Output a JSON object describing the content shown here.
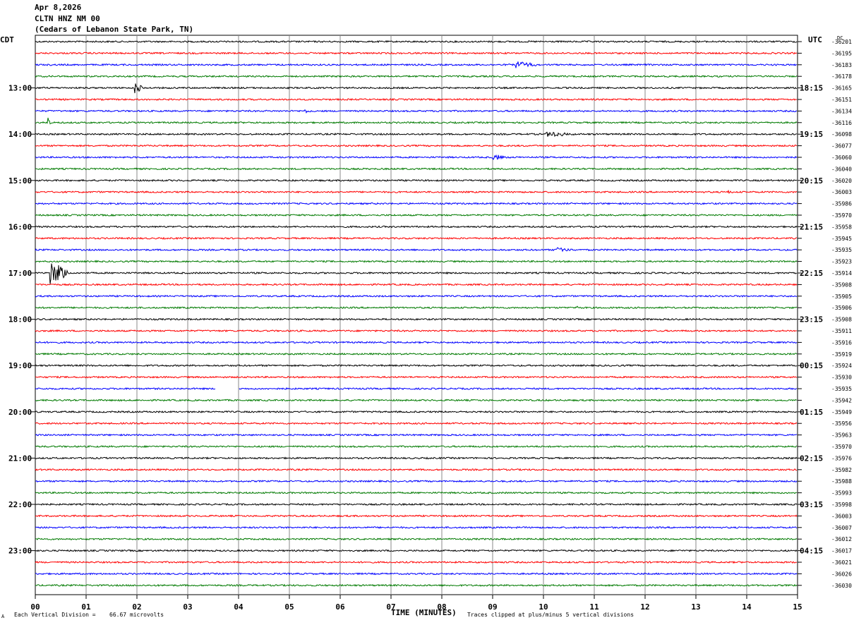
{
  "header": {
    "date": "Apr 8,2026",
    "station": "CLTN HNZ NM 00",
    "location": "(Cedars of Lebanon State Park, TN)"
  },
  "left_tz": "CDT",
  "right_tz": "UTC",
  "dc_label": "DC",
  "footer": {
    "scale_prefix": "Each Vertical Division =",
    "scale_value": "66.67 microvolts",
    "x_title": "TIME (MINUTES)",
    "clip_note": "Traces clipped at plus/minus 5 vertical divisions",
    "corner_mark": "A"
  },
  "chart_data": {
    "type": "line",
    "x": {
      "label": "TIME (MINUTES)",
      "range": [
        0,
        15
      ],
      "ticks": [
        "00",
        "01",
        "02",
        "03",
        "04",
        "05",
        "06",
        "07",
        "08",
        "09",
        "10",
        "11",
        "12",
        "13",
        "14",
        "15"
      ]
    },
    "rows": 48,
    "row_colors": [
      "#000000",
      "#ff0000",
      "#0000ff",
      "#007a00"
    ],
    "grid": true,
    "left_hour_labels": [
      "13:00",
      "14:00",
      "15:00",
      "16:00",
      "17:00",
      "18:00",
      "19:00",
      "20:00",
      "21:00",
      "22:00",
      "23:00"
    ],
    "right_hour_labels": [
      "18:15",
      "19:15",
      "20:15",
      "21:15",
      "22:15",
      "23:15",
      "00:15",
      "01:15",
      "02:15",
      "03:15",
      "04:15"
    ],
    "dc_offsets": [
      "-36201",
      "-36195",
      "-36183",
      "-36178",
      "-36165",
      "-36151",
      "-36134",
      "-36116",
      "-36098",
      "-36077",
      "-36060",
      "-36040",
      "-36020",
      "-36003",
      "-35986",
      "-35970",
      "-35958",
      "-35945",
      "-35935",
      "-35923",
      "-35914",
      "-35908",
      "-35905",
      "-35906",
      "-35908",
      "-35911",
      "-35916",
      "-35919",
      "-35924",
      "-35930",
      "-35935",
      "-35942",
      "-35949",
      "-35956",
      "-35963",
      "-35970",
      "-35976",
      "-35982",
      "-35988",
      "-35993",
      "-35998",
      "-36003",
      "-36007",
      "-36012",
      "-36017",
      "-36021",
      "-36026",
      "-36030"
    ],
    "events": [
      {
        "row": 2,
        "minute": 9.45,
        "amp": 6,
        "dur": 0.55
      },
      {
        "row": 4,
        "minute": 1.95,
        "amp": 8,
        "dur": 0.2
      },
      {
        "row": 6,
        "minute": 5.3,
        "amp": 2,
        "dur": 0.2
      },
      {
        "row": 6,
        "minute": 10.6,
        "amp": 2,
        "dur": 0.4
      },
      {
        "row": 7,
        "minute": 0.25,
        "amp": 8,
        "dur": 0.08
      },
      {
        "row": 8,
        "minute": 10.05,
        "amp": 4,
        "dur": 0.6
      },
      {
        "row": 10,
        "minute": 9.0,
        "amp": 5,
        "dur": 0.3
      },
      {
        "row": 13,
        "minute": 13.6,
        "amp": 2,
        "dur": 0.2
      },
      {
        "row": 18,
        "minute": 10.25,
        "amp": 4,
        "dur": 0.4
      },
      {
        "row": 20,
        "minute": 0.28,
        "amp": 20,
        "dur": 0.45
      },
      {
        "row": 23,
        "minute": 10.6,
        "amp": 2,
        "dur": 0.15
      }
    ],
    "gap": {
      "row": 30,
      "start": 3.55,
      "end": 4.0
    }
  }
}
